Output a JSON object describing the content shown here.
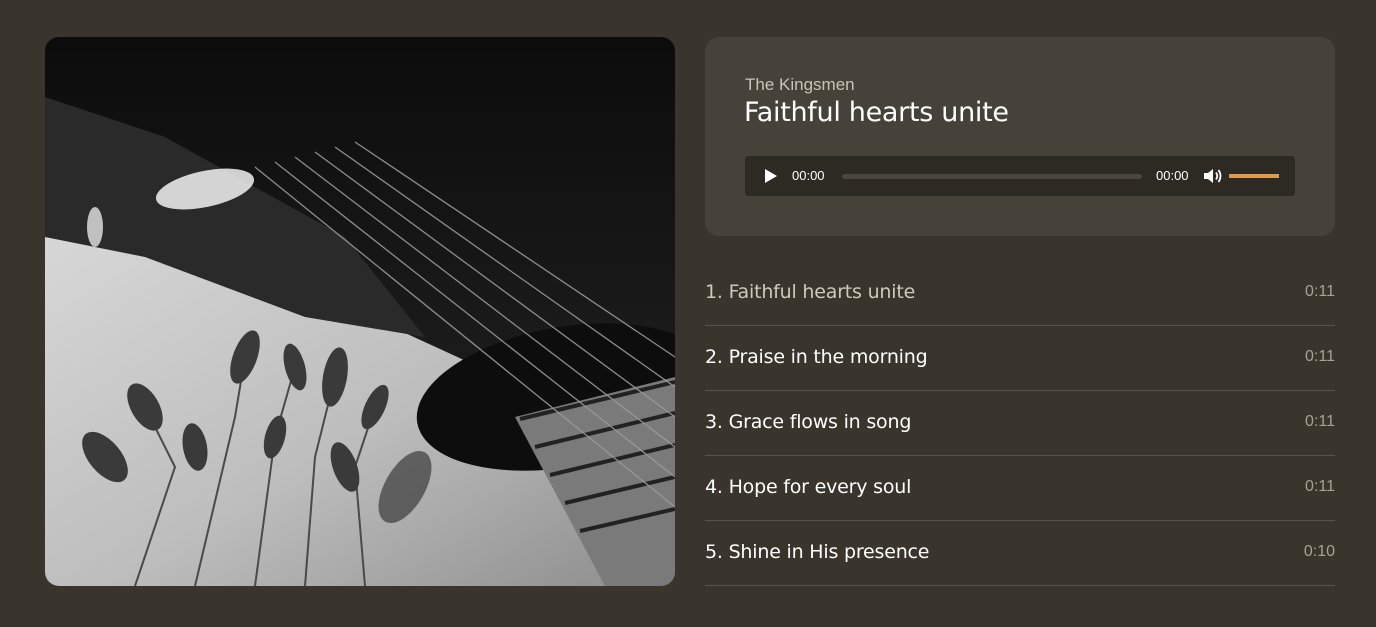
{
  "colors": {
    "background": "#39352c",
    "card": "#46423a",
    "player_bar": "#2d2a24",
    "accent": "#dc9b4d",
    "divider": "#58534a",
    "active_track_text": "#cfc9bc"
  },
  "cover": {
    "icon": "album-cover-image"
  },
  "player": {
    "artist": "The Kingsmen",
    "title": "Faithful hearts unite",
    "current_time": "00:00",
    "total_time": "00:00",
    "progress": 0,
    "volume": 1.0,
    "play_icon": "play-icon",
    "volume_icon": "speaker-icon"
  },
  "playlist": {
    "active_index": 0,
    "items": [
      {
        "title": "1. Faithful hearts unite",
        "duration": "0:11"
      },
      {
        "title": "2. Praise in the morning",
        "duration": "0:11"
      },
      {
        "title": "3. Grace flows in song",
        "duration": "0:11"
      },
      {
        "title": "4. Hope for every soul",
        "duration": "0:11"
      },
      {
        "title": "5. Shine in His presence",
        "duration": "0:10"
      }
    ]
  }
}
